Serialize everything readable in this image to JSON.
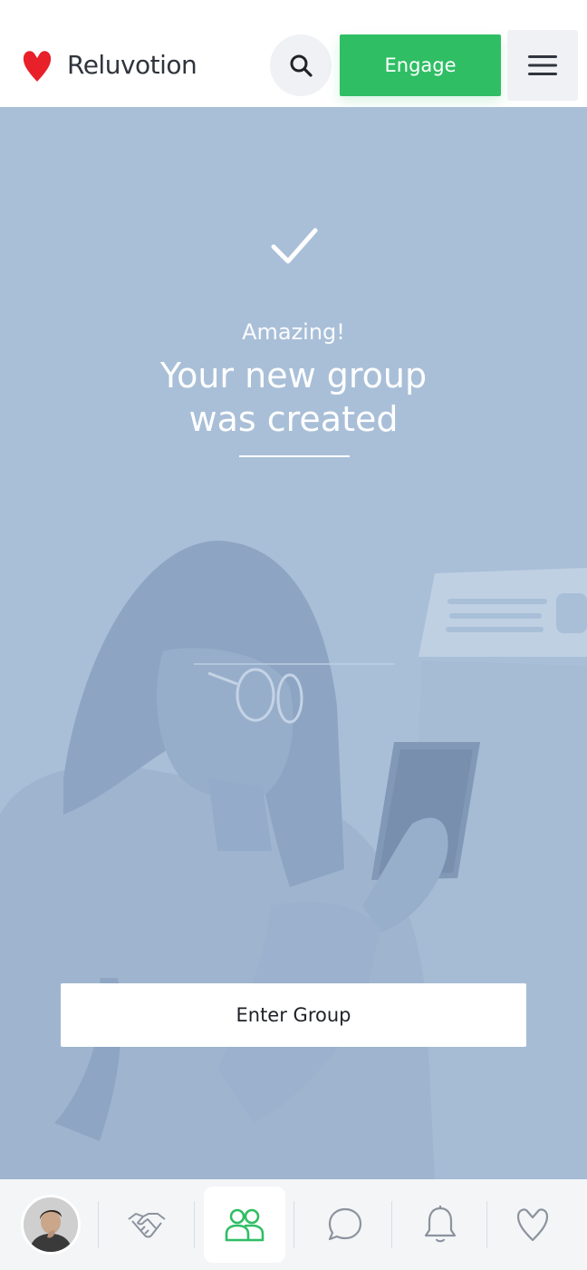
{
  "header": {
    "brand": "Reluvotion",
    "engage_label": "Engage",
    "search_icon": "search-icon",
    "menu_icon": "hamburger-menu-icon"
  },
  "hero": {
    "check_icon": "checkmark-icon",
    "subtitle": "Amazing!",
    "title_line1": "Your new group",
    "title_line2": "was created",
    "enter_label": "Enter Group",
    "background_color": "#a9bfd8"
  },
  "bottom_nav": {
    "items": [
      {
        "icon": "avatar",
        "active": false
      },
      {
        "icon": "handshake-icon",
        "active": false
      },
      {
        "icon": "group-icon",
        "active": true
      },
      {
        "icon": "chat-bubble-icon",
        "active": false
      },
      {
        "icon": "bell-icon",
        "active": false
      },
      {
        "icon": "heart-icon",
        "active": false
      }
    ]
  },
  "colors": {
    "brand_red": "#e8202a",
    "accent_green": "#2fbe64",
    "text_dark": "#2f343d"
  }
}
